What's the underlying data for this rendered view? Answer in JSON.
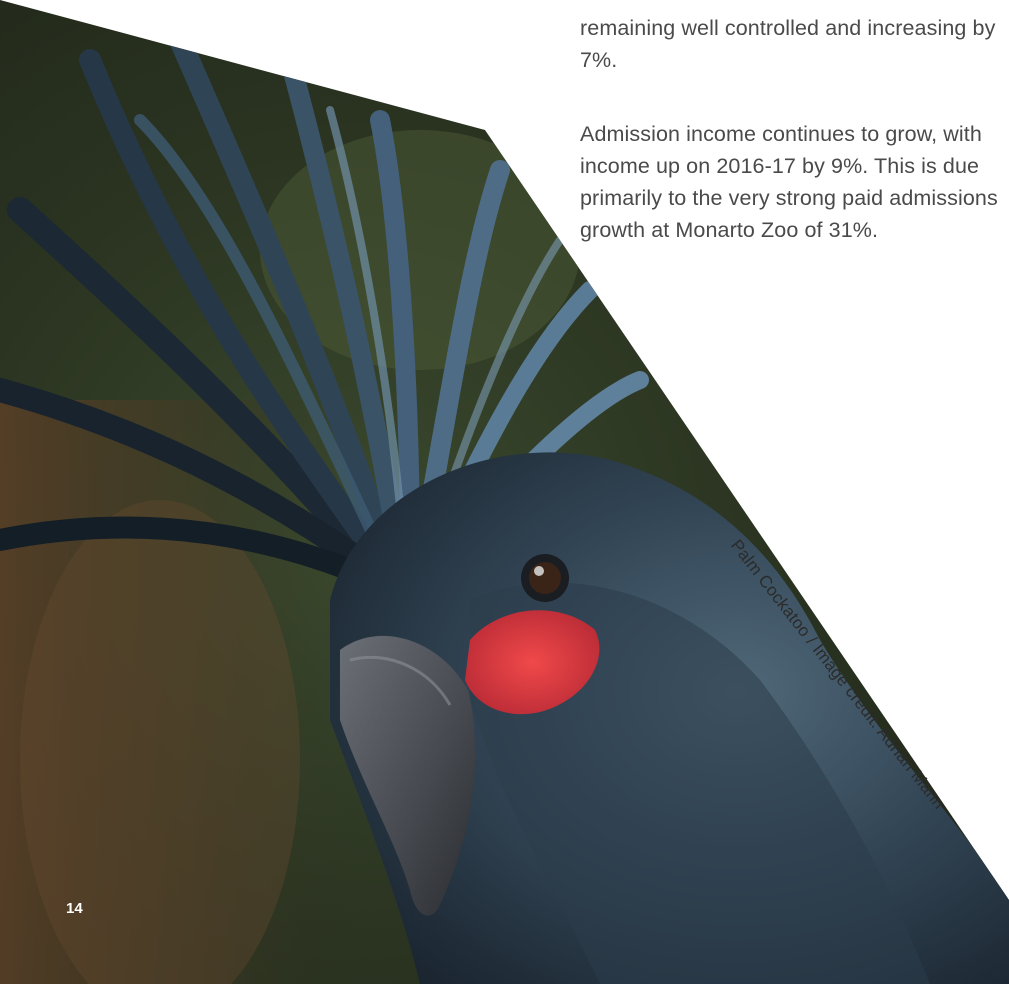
{
  "document": {
    "paragraph_1": "remaining well controlled and increasing by 7%.",
    "paragraph_2": "Admission income continues to grow, with income up on 2016-17 by 9%. This is due primarily to the very strong paid admissions growth at Monarto Zoo of 31%.",
    "photo_caption": "Palm Cockatoo / Image credit: Adrian Mann",
    "page_number": "14"
  },
  "photo": {
    "subject": "palm-cockatoo-photo"
  }
}
